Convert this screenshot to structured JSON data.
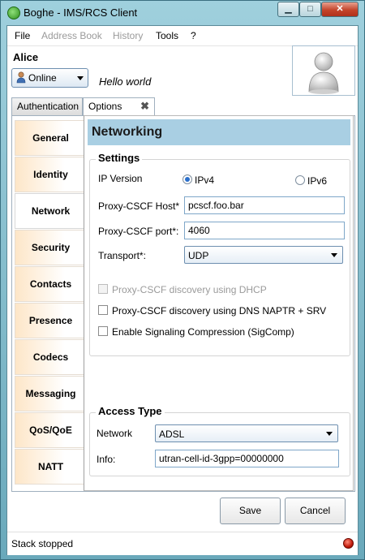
{
  "window": {
    "title": "Boghe - IMS/RCS Client",
    "min_glyph": "▁",
    "max_glyph": "□",
    "close_glyph": "✕"
  },
  "menu": [
    "File",
    "Address Book",
    "History",
    "Tools",
    "?"
  ],
  "user": {
    "name": "Alice",
    "status": "Online",
    "free_text": "Hello world"
  },
  "tabs": [
    {
      "label": "Authentication"
    },
    {
      "label": "Options",
      "close": "✖"
    }
  ],
  "nav": [
    "General",
    "Identity",
    "Network",
    "Security",
    "Contacts",
    "Presence",
    "Codecs",
    "Messaging",
    "QoS/QoE",
    "NATT"
  ],
  "page": {
    "header": "Networking",
    "settings": {
      "title": "Settings",
      "ip_version_label": "IP Version",
      "ipv4": "IPv4",
      "ipv6": "IPv6",
      "host_label": "Proxy-CSCF Host*",
      "host_value": "pcscf.foo.bar",
      "port_label": "Proxy-CSCF port*:",
      "port_value": "4060",
      "transport_label": "Transport*:",
      "transport_value": "UDP",
      "dhcp_label": "Proxy-CSCF discovery using DHCP",
      "naptr_label": "Proxy-CSCF discovery using DNS NAPTR + SRV",
      "sigcomp_label": "Enable Signaling Compression (SigComp)"
    },
    "access": {
      "title": "Access Type",
      "network_label": "Network",
      "network_value": "ADSL",
      "info_label": "Info:",
      "info_value": "utran-cell-id-3gpp=00000000"
    }
  },
  "buttons": {
    "save": "Save",
    "cancel": "Cancel"
  },
  "statusbar": {
    "text": "Stack stopped"
  }
}
